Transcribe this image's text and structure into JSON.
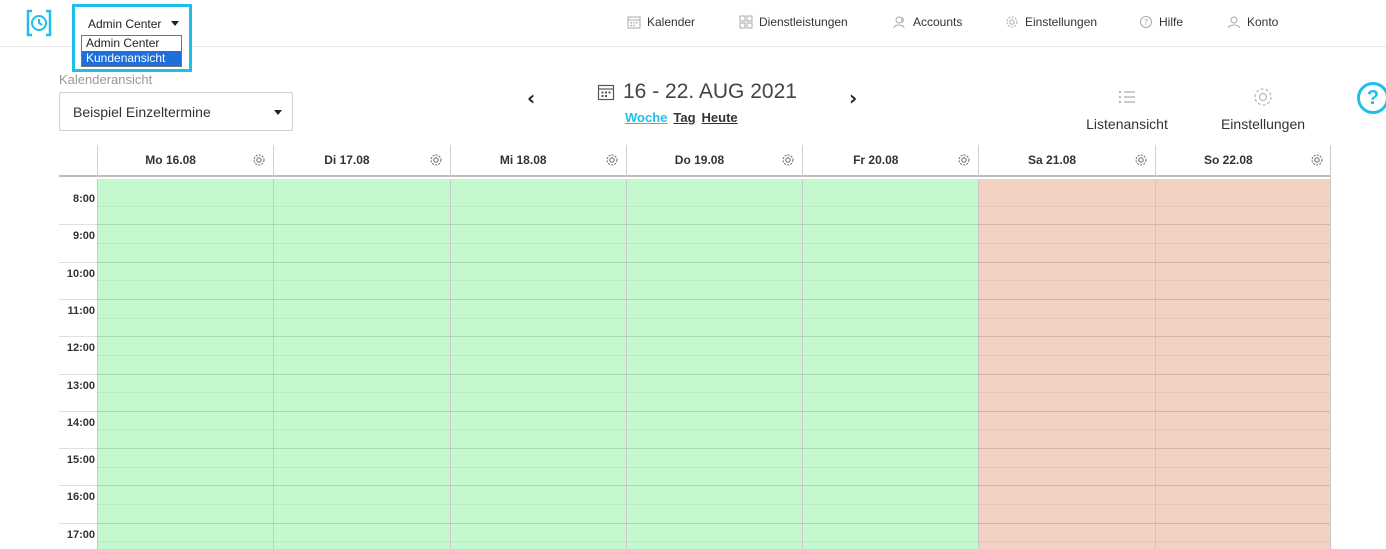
{
  "colors": {
    "accent": "#1ec0e8",
    "open": "#c4f8cf",
    "closed": "#f3d2c4",
    "selected_option": "#1e6fd9"
  },
  "app_select": {
    "current": "Admin Center",
    "options": [
      {
        "label": "Admin Center",
        "selected": false
      },
      {
        "label": "Kundenansicht",
        "selected": true
      }
    ]
  },
  "nav": [
    {
      "label": "Kalender",
      "icon": "calendar-icon"
    },
    {
      "label": "Dienstleistungen",
      "icon": "grid-icon"
    },
    {
      "label": "Accounts",
      "icon": "users-icon"
    },
    {
      "label": "Einstellungen",
      "icon": "gear-icon"
    },
    {
      "label": "Hilfe",
      "icon": "help-icon"
    },
    {
      "label": "Konto",
      "icon": "user-icon"
    }
  ],
  "calendar_view": {
    "label": "Kalenderansicht",
    "value": "Beispiel Einzeltermine"
  },
  "date_range": {
    "title": "16 - 22. AUG 2021",
    "prev_icon": "chevron-left-icon",
    "next_icon": "chevron-right-icon"
  },
  "range_links": [
    {
      "label": "Woche",
      "active": true
    },
    {
      "label": "Tag",
      "active": false
    },
    {
      "label": "Heute",
      "active": false
    }
  ],
  "toolbar": {
    "list_label": "Listenansicht",
    "settings_label": "Einstellungen"
  },
  "help_button": {
    "label": "?"
  },
  "days": [
    {
      "label": "Mo 16.08",
      "status": "open"
    },
    {
      "label": "Di 17.08",
      "status": "open"
    },
    {
      "label": "Mi 18.08",
      "status": "open"
    },
    {
      "label": "Do 19.08",
      "status": "open"
    },
    {
      "label": "Fr 20.08",
      "status": "open"
    },
    {
      "label": "Sa 21.08",
      "status": "closed"
    },
    {
      "label": "So 22.08",
      "status": "closed"
    }
  ],
  "hours": [
    "8:00",
    "9:00",
    "10:00",
    "11:00",
    "12:00",
    "13:00",
    "14:00",
    "15:00",
    "16:00",
    "17:00"
  ]
}
